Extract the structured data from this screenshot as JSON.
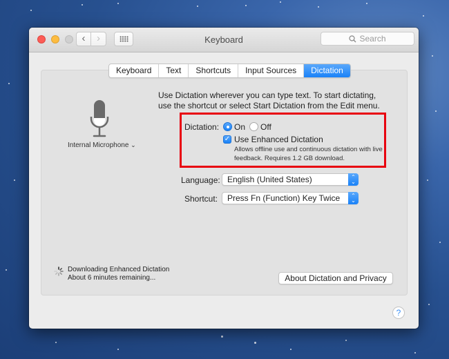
{
  "window": {
    "title": "Keyboard",
    "search_placeholder": "Search",
    "nav": {
      "back": "‹",
      "forward": "›"
    }
  },
  "tabs": [
    {
      "label": "Keyboard",
      "active": false
    },
    {
      "label": "Text",
      "active": false
    },
    {
      "label": "Shortcuts",
      "active": false
    },
    {
      "label": "Input Sources",
      "active": false
    },
    {
      "label": "Dictation",
      "active": true
    }
  ],
  "microphone": {
    "label": "Internal Microphone",
    "chevron": "⌄"
  },
  "intro_text": "Use Dictation wherever you can type text. To start dictating, use the shortcut or select Start Dictation from the Edit menu.",
  "dictation": {
    "label": "Dictation:",
    "on_label": "On",
    "off_label": "Off",
    "selected": "On",
    "enhanced": {
      "label": "Use Enhanced Dictation",
      "checked": true,
      "description": "Allows offline use and continuous dictation with live feedback. Requires 1.2 GB download."
    }
  },
  "language": {
    "label": "Language:",
    "value": "English (United States)"
  },
  "shortcut": {
    "label": "Shortcut:",
    "value": "Press Fn (Function) Key Twice"
  },
  "download": {
    "line1": "Downloading Enhanced Dictation",
    "line2": "About 6 minutes remaining..."
  },
  "about_button": "About Dictation and Privacy",
  "help_button": "?",
  "colors": {
    "accent": "#1a82f8",
    "highlight_box": "#e8000f"
  }
}
